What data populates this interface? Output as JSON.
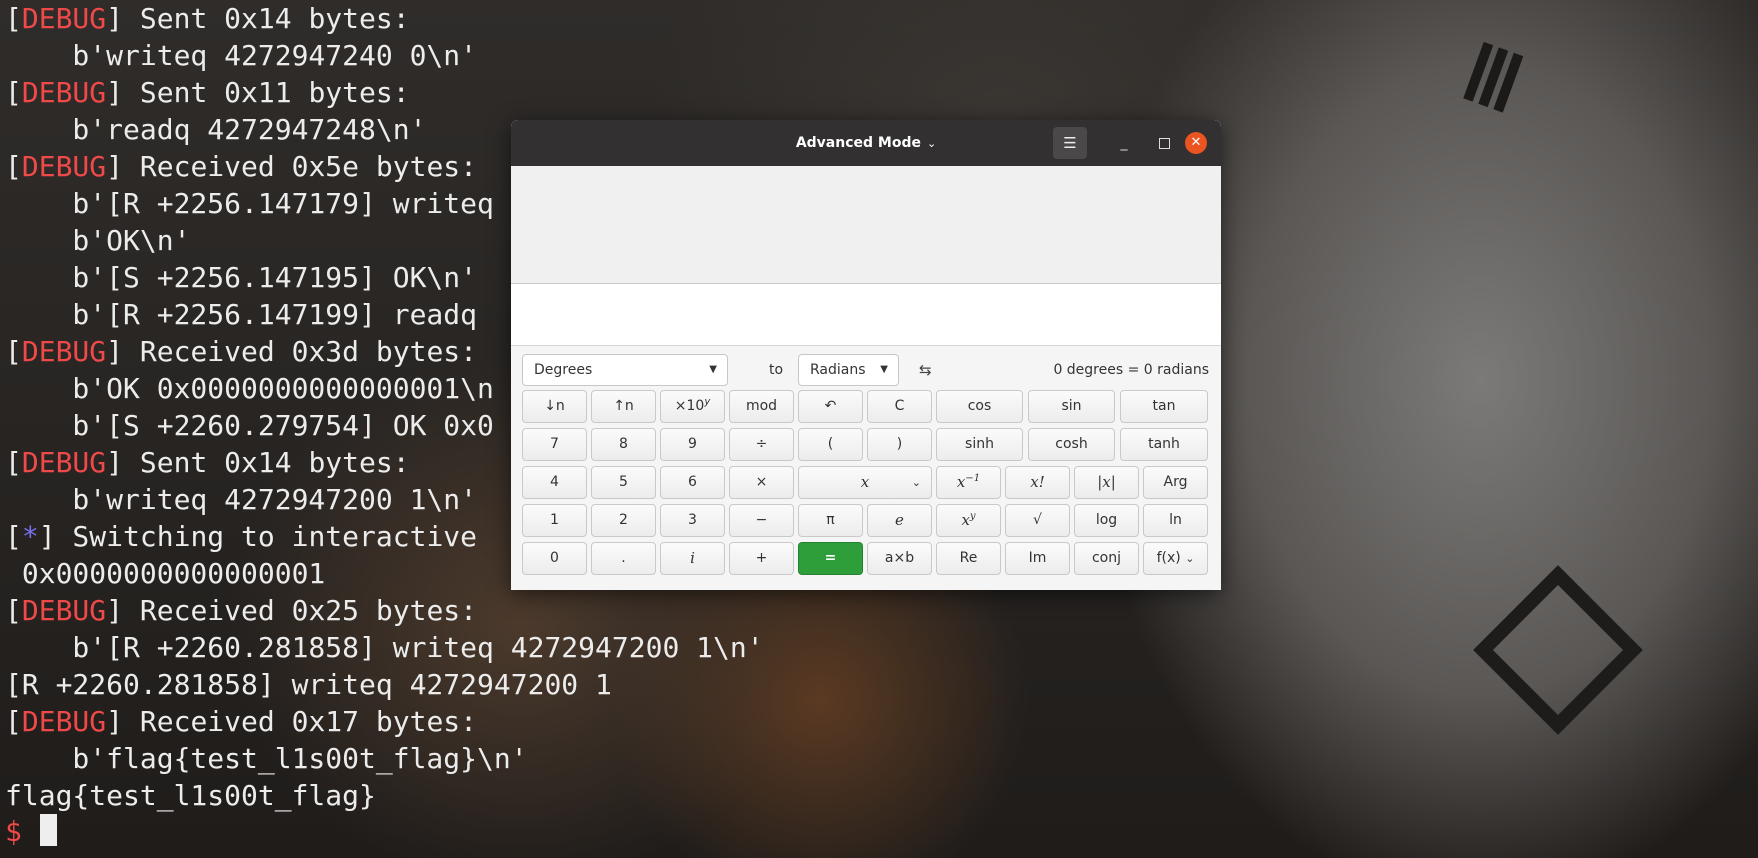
{
  "terminal": {
    "lines": [
      {
        "tag": "DEBUG",
        "text": " Sent 0x14 bytes:"
      },
      {
        "tag": "",
        "text": "    b'writeq 4272947240 0\\n'"
      },
      {
        "tag": "DEBUG",
        "text": " Sent 0x11 bytes:"
      },
      {
        "tag": "",
        "text": "    b'readq 4272947248\\n'"
      },
      {
        "tag": "DEBUG",
        "text": " Received 0x5e bytes:"
      },
      {
        "tag": "",
        "text": "    b'[R +2256.147179] writeq"
      },
      {
        "tag": "",
        "text": "    b'OK\\n'"
      },
      {
        "tag": "",
        "text": "    b'[S +2256.147195] OK\\n'"
      },
      {
        "tag": "",
        "text": "    b'[R +2256.147199] readq"
      },
      {
        "tag": "DEBUG",
        "text": " Received 0x3d bytes:"
      },
      {
        "tag": "",
        "text": "    b'OK 0x0000000000000001\\n"
      },
      {
        "tag": "",
        "text": "    b'[S +2260.279754] OK 0x0"
      },
      {
        "tag": "DEBUG",
        "text": " Sent 0x14 bytes:"
      },
      {
        "tag": "",
        "text": "    b'writeq 4272947200 1\\n'"
      },
      {
        "tag": "*",
        "text": " Switching to interactive"
      },
      {
        "tag": "",
        "text": " 0x0000000000000001"
      },
      {
        "tag": "DEBUG",
        "text": " Received 0x25 bytes:"
      },
      {
        "tag": "",
        "text": "    b'[R +2260.281858] writeq 4272947200 1\\n'"
      },
      {
        "tag": "",
        "text": "[R +2260.281858] writeq 4272947200 1"
      },
      {
        "tag": "DEBUG",
        "text": " Received 0x17 bytes:"
      },
      {
        "tag": "",
        "text": "    b'flag{test_l1s00t_flag}\\n'"
      },
      {
        "tag": "",
        "text": "flag{test_l1s00t_flag}"
      }
    ],
    "prompt": "$",
    "colors": {
      "debug": "#ef4949",
      "star": "#7a6ff0",
      "text": "#ececec"
    }
  },
  "calculator": {
    "title": "Advanced Mode",
    "menu_icon": "hamburger-icon",
    "minimize_glyph": "_",
    "close_glyph": "✕",
    "conversion": {
      "from_unit": "Degrees",
      "to_label": "to",
      "to_unit": "Radians",
      "swap_glyph": "⇆",
      "result": "0 degrees  =  0 radians"
    },
    "keys": [
      [
        "↓n",
        "↑n",
        "×10^y",
        "mod",
        "↶",
        "C",
        "cos",
        "sin",
        "tan"
      ],
      [
        "7",
        "8",
        "9",
        "÷",
        "(",
        ")",
        "sinh",
        "cosh",
        "tanh"
      ],
      [
        "4",
        "5",
        "6",
        "×",
        "x",
        "x^-1",
        "x!",
        "|x|",
        "Arg"
      ],
      [
        "1",
        "2",
        "3",
        "−",
        "π",
        "e",
        "x^y",
        "√",
        "log",
        "ln"
      ],
      [
        "0",
        ".",
        "i",
        "+",
        "=",
        "a×b",
        "Re",
        "Im",
        "conj",
        "f(x)"
      ]
    ],
    "accent_color": "#2d9e3a",
    "close_color": "#e95420"
  }
}
